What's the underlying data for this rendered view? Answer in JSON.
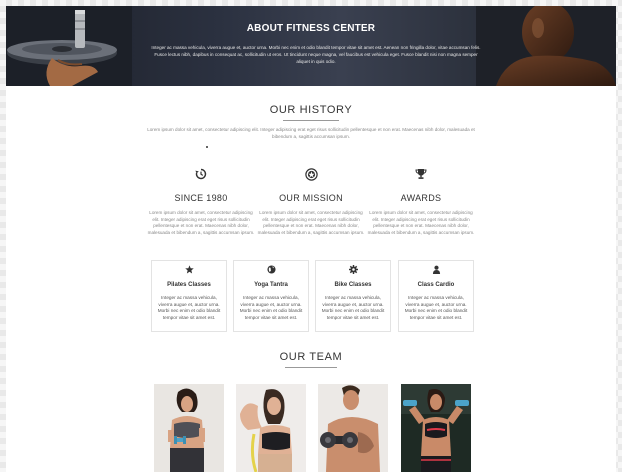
{
  "hero": {
    "title": "ABOUT FITNESS CENTER",
    "text": "Integer ac massa vehicula, viverra augue et, auctor urna. Morbi nec enim et odio blandit tempor vitae sit amet est. Aenean non fringilla dolor, vitae accumsan felis. Fusce lectus nibh, dapibus in consequat ac, sollicitudin ut eros. Ut tincidunt neque magna, vel faucibus est vehicula eget. Fusce blandit nisi non magna semper aliquet in quis odio."
  },
  "history": {
    "title": "OUR HISTORY",
    "text": "Lorem ipsum dolor sit amet, consectetur adipiscing elit. Integer adipiscing erat eget risus sollicitudin pellentesque et non erat. Maecenas nibh dolor, malesuada et bibendum a, sagittis accumsan ipsum."
  },
  "features": [
    {
      "icon": "history-icon",
      "title": "SINCE 1980",
      "text": "Lorem ipsum dolor sit amet, consectetur adipiscing elit. Integer adipiscing erat eget risus sollicitudin pellentesque et non erat. Maecenas nibh dolor, malesuada et bibendum a, sagittis accumsan ipsum."
    },
    {
      "icon": "emblem-icon",
      "title": "OUR MISSION",
      "text": "Lorem ipsum dolor sit amet, consectetur adipiscing elit. Integer adipiscing erat eget risus sollicitudin pellentesque et non erat. Maecenas nibh dolor, malesuada et bibendum a, sagittis accumsan ipsum."
    },
    {
      "icon": "trophy-icon",
      "title": "AWARDS",
      "text": "Lorem ipsum dolor sit amet, consectetur adipiscing elit. Integer adipiscing erat eget risus sollicitudin pellentesque et non erat. Maecenas nibh dolor, malesuada et bibendum a, sagittis accumsan ipsum."
    }
  ],
  "classes": [
    {
      "icon": "star-icon",
      "title": "Pilates Classes",
      "text": "Integer ac massa vehicula, viverra augue et, auctor urna. Morbi nec enim et odio blandit tempor vitae sit amet est."
    },
    {
      "icon": "globe-icon",
      "title": "Yoga Tantra",
      "text": "Integer ac massa vehicula, viverra augue et, auctor urna. Morbi nec enim et odio blandit tempor vitae sit amet est."
    },
    {
      "icon": "gear-icon",
      "title": "Bike Classes",
      "text": "Integer ac massa vehicula, viverra augue et, auctor urna. Morbi nec enim et odio blandit tempor vitae sit amet est."
    },
    {
      "icon": "user-icon",
      "title": "Class Cardio",
      "text": "Integer ac massa vehicula, viverra augue et, auctor urna. Morbi nec enim et odio blandit tempor vitae sit amet est."
    }
  ],
  "team": {
    "title": "OUR TEAM",
    "members": [
      {
        "photo": "team-photo-woman-dumbbells"
      },
      {
        "photo": "team-photo-woman-flexing"
      },
      {
        "photo": "team-photo-man-dumbbell"
      },
      {
        "photo": "team-photo-woman-weights"
      }
    ]
  },
  "colors": {
    "hero_bg": "#2b3140",
    "text_dark": "#333333",
    "text_muted": "#888888",
    "card_border": "#e3e3e3"
  }
}
